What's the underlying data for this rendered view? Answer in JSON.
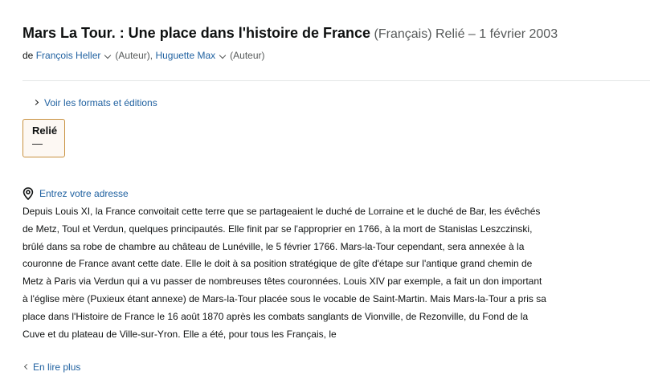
{
  "product": {
    "title": "Mars La Tour. : Une place dans l'histoire de France",
    "language": "(Français)",
    "format_date": "Relié – 1 février 2003"
  },
  "byline": {
    "prefix": "de",
    "authors": [
      {
        "name": "François Heller",
        "role": "(Auteur),"
      },
      {
        "name": "Huguette Max",
        "role": "(Auteur)"
      }
    ]
  },
  "formats": {
    "see_all_label": "Voir les formats et éditions",
    "selected": {
      "name": "Relié",
      "price": "—"
    }
  },
  "delivery": {
    "address_label": "Entrez votre adresse",
    "icon": "location-pin-icon"
  },
  "description": {
    "text": "Depuis Louis XI, la France convoitait cette terre que se partageaient le duché de Lorraine et le duché de Bar, les évêchés de Metz, Toul et Verdun, quelques principautés. Elle finit par se l'approprier en 1766, à la mort de Stanislas Leszczinski, brûlé dans sa robe de chambre au château de Lunéville, le 5 février 1766. Mars-la-Tour cependant, sera annexée à la couronne de France avant cette date. Elle le doit à sa position stratégique de gîte d'étape sur l'antique grand chemin de Metz à Paris via Verdun qui a vu passer de nombreuses têtes couronnées. Louis XIV par exemple, a fait un don important à l'église mère (Puxieux étant annexe) de Mars-la-Tour placée sous le vocable de Saint-Martin. Mais Mars-la-Tour a pris sa place dans l'Histoire de France le 16 août 1870 après les combats sanglants de Vionville, de Rezonville, du Fond de la Cuve et du plateau de Ville-sur-Yron. Elle a été, pour tous les Français, le",
    "read_more_label": "En lire plus"
  },
  "colors": {
    "link": "#2162a1",
    "text": "#0f1111",
    "muted": "#565959",
    "selected_border": "#c8913f",
    "selected_bg": "#fdf8f3",
    "divider": "#e3e6e6"
  }
}
